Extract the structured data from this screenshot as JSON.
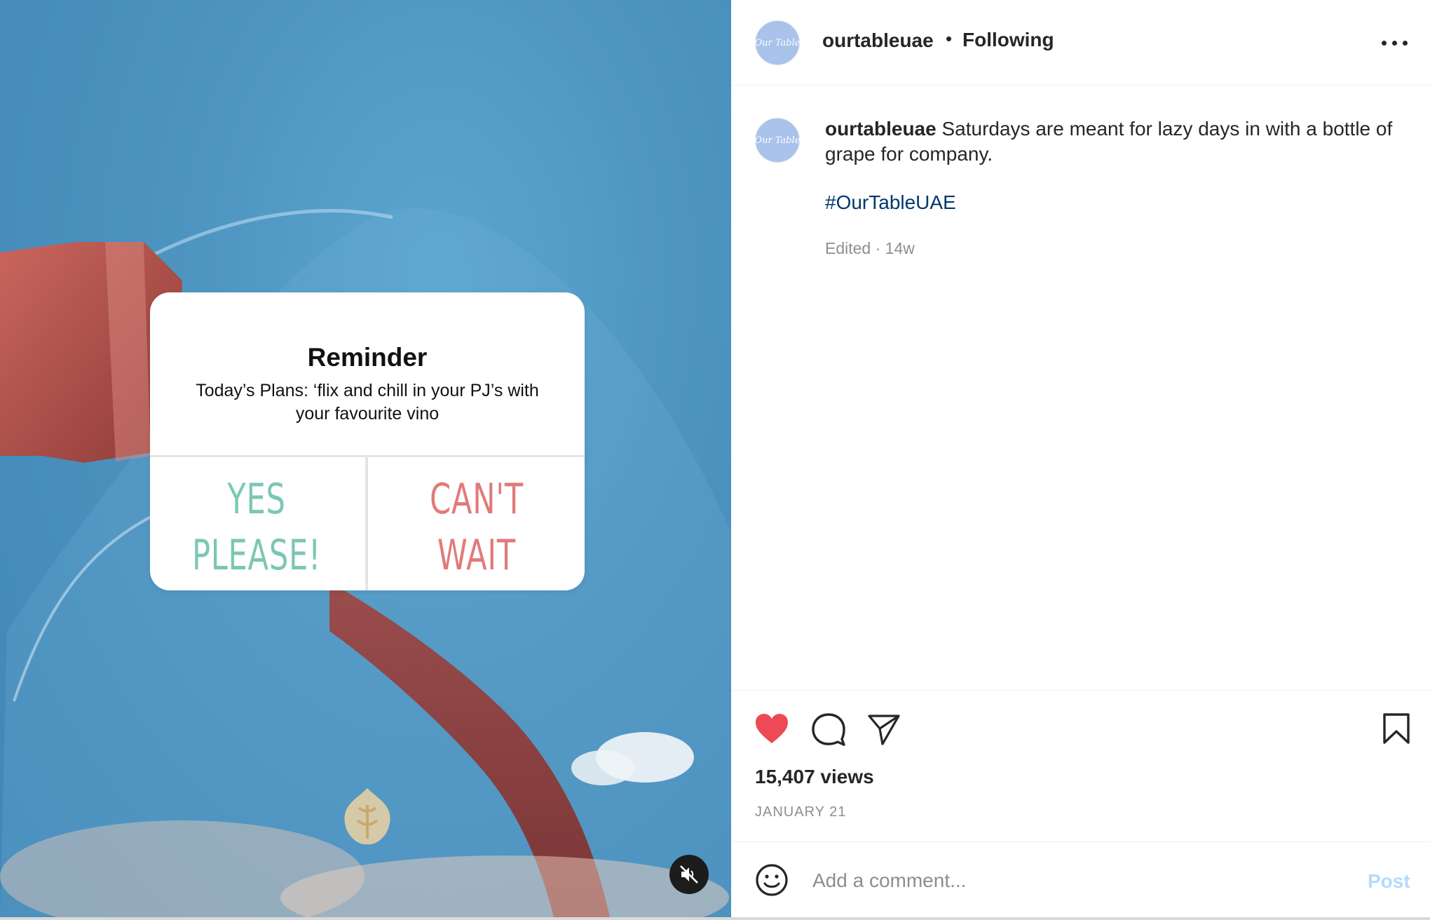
{
  "post": {
    "username": "ourtableuae",
    "follow_status": "Following",
    "avatar_text": "Our Table",
    "separator": "•"
  },
  "media": {
    "type": "video",
    "reminder": {
      "title": "Reminder",
      "body": "Today’s Plans: ‘flix and chill in your PJ’s with your favourite vino",
      "option_1": "YES PLEASE!",
      "option_2": "CAN'T WAIT"
    },
    "mute_icon": "speaker-muted-icon"
  },
  "caption": {
    "username": "ourtableuae",
    "text": "Saturdays are meant for lazy days in with a bottle of grape for company.",
    "hashtag": "#OurTableUAE",
    "meta": "Edited · 14w"
  },
  "actions": {
    "like_icon": "heart-filled-icon",
    "comment_icon": "comment-icon",
    "share_icon": "paper-plane-icon",
    "save_icon": "bookmark-icon",
    "liked_color": "#ed4956"
  },
  "stats": {
    "views": "15,407 views",
    "date": "JANUARY 21"
  },
  "comment": {
    "placeholder": "Add a comment...",
    "post_label": "Post",
    "emoji_icon": "smiley-icon",
    "post_color": "#b3dbff"
  }
}
